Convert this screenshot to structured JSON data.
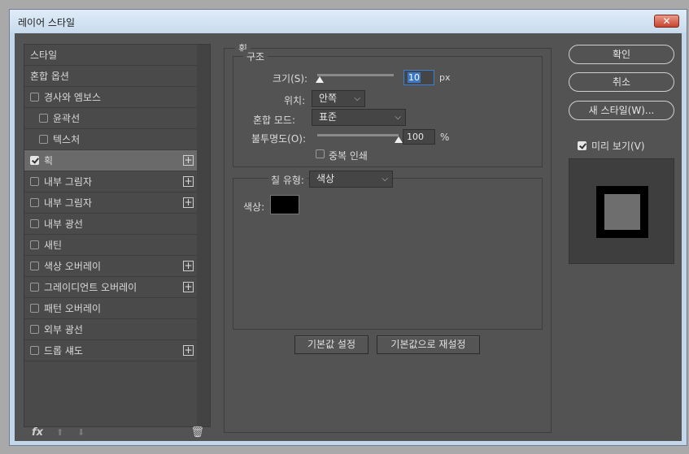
{
  "window": {
    "title": "레이어 스타일",
    "close_label": "✕"
  },
  "styles_list": {
    "items": [
      {
        "label": "스타일",
        "checkbox": false,
        "checked": false,
        "plus": false,
        "indent": false,
        "selected": false
      },
      {
        "label": "혼합 옵션",
        "checkbox": false,
        "checked": false,
        "plus": false,
        "indent": false,
        "selected": false
      },
      {
        "label": "경사와 엠보스",
        "checkbox": true,
        "checked": false,
        "plus": false,
        "indent": false,
        "selected": false
      },
      {
        "label": "윤곽선",
        "checkbox": true,
        "checked": false,
        "plus": false,
        "indent": true,
        "selected": false
      },
      {
        "label": "텍스처",
        "checkbox": true,
        "checked": false,
        "plus": false,
        "indent": true,
        "selected": false
      },
      {
        "label": "획",
        "checkbox": true,
        "checked": true,
        "plus": true,
        "indent": false,
        "selected": true
      },
      {
        "label": "내부 그림자",
        "checkbox": true,
        "checked": false,
        "plus": true,
        "indent": false,
        "selected": false
      },
      {
        "label": "내부 그림자",
        "checkbox": true,
        "checked": false,
        "plus": true,
        "indent": false,
        "selected": false
      },
      {
        "label": "내부 광선",
        "checkbox": true,
        "checked": false,
        "plus": false,
        "indent": false,
        "selected": false
      },
      {
        "label": "새틴",
        "checkbox": true,
        "checked": false,
        "plus": false,
        "indent": false,
        "selected": false
      },
      {
        "label": "색상 오버레이",
        "checkbox": true,
        "checked": false,
        "plus": true,
        "indent": false,
        "selected": false
      },
      {
        "label": "그레이디언트 오버레이",
        "checkbox": true,
        "checked": false,
        "plus": true,
        "indent": false,
        "selected": false
      },
      {
        "label": "패턴 오버레이",
        "checkbox": true,
        "checked": false,
        "plus": false,
        "indent": false,
        "selected": false
      },
      {
        "label": "외부 광선",
        "checkbox": true,
        "checked": false,
        "plus": false,
        "indent": false,
        "selected": false
      },
      {
        "label": "드롭 섀도",
        "checkbox": true,
        "checked": false,
        "plus": true,
        "indent": false,
        "selected": false
      }
    ],
    "plus_symbol": "+",
    "tools": {
      "fx": "fx",
      "up": "⬆",
      "down": "⬇",
      "trash": "🗑"
    }
  },
  "stroke": {
    "section_title": "획",
    "structure": {
      "title": "구조",
      "size_label": "크기(S):",
      "size_value": "10",
      "size_unit": "px",
      "size_slider_level": 0.03,
      "position_label": "위치:",
      "position_value": "안쪽",
      "blend_label": "혼합 모드:",
      "blend_value": "표준",
      "opacity_label": "불투명도(O):",
      "opacity_value": "100",
      "opacity_unit": "%",
      "opacity_slider_level": 1.0,
      "overprint_label": "중복 인쇄"
    },
    "fill": {
      "fill_type_label": "칠 유형:",
      "fill_type_value": "색상",
      "color_label": "색상:",
      "color": "#000000"
    },
    "buttons": {
      "make_default": "기본값 설정",
      "reset_default": "기본값으로 재설정"
    }
  },
  "actions": {
    "ok": "확인",
    "cancel": "취소",
    "new_style": "새 스타일(W)...",
    "preview_label": "미리 보기(V)",
    "preview_checked": true
  },
  "colors": {
    "panel_bg": "#535353",
    "selected_item": "#6a6a6a",
    "focus_blue": "#3b7fd6"
  }
}
